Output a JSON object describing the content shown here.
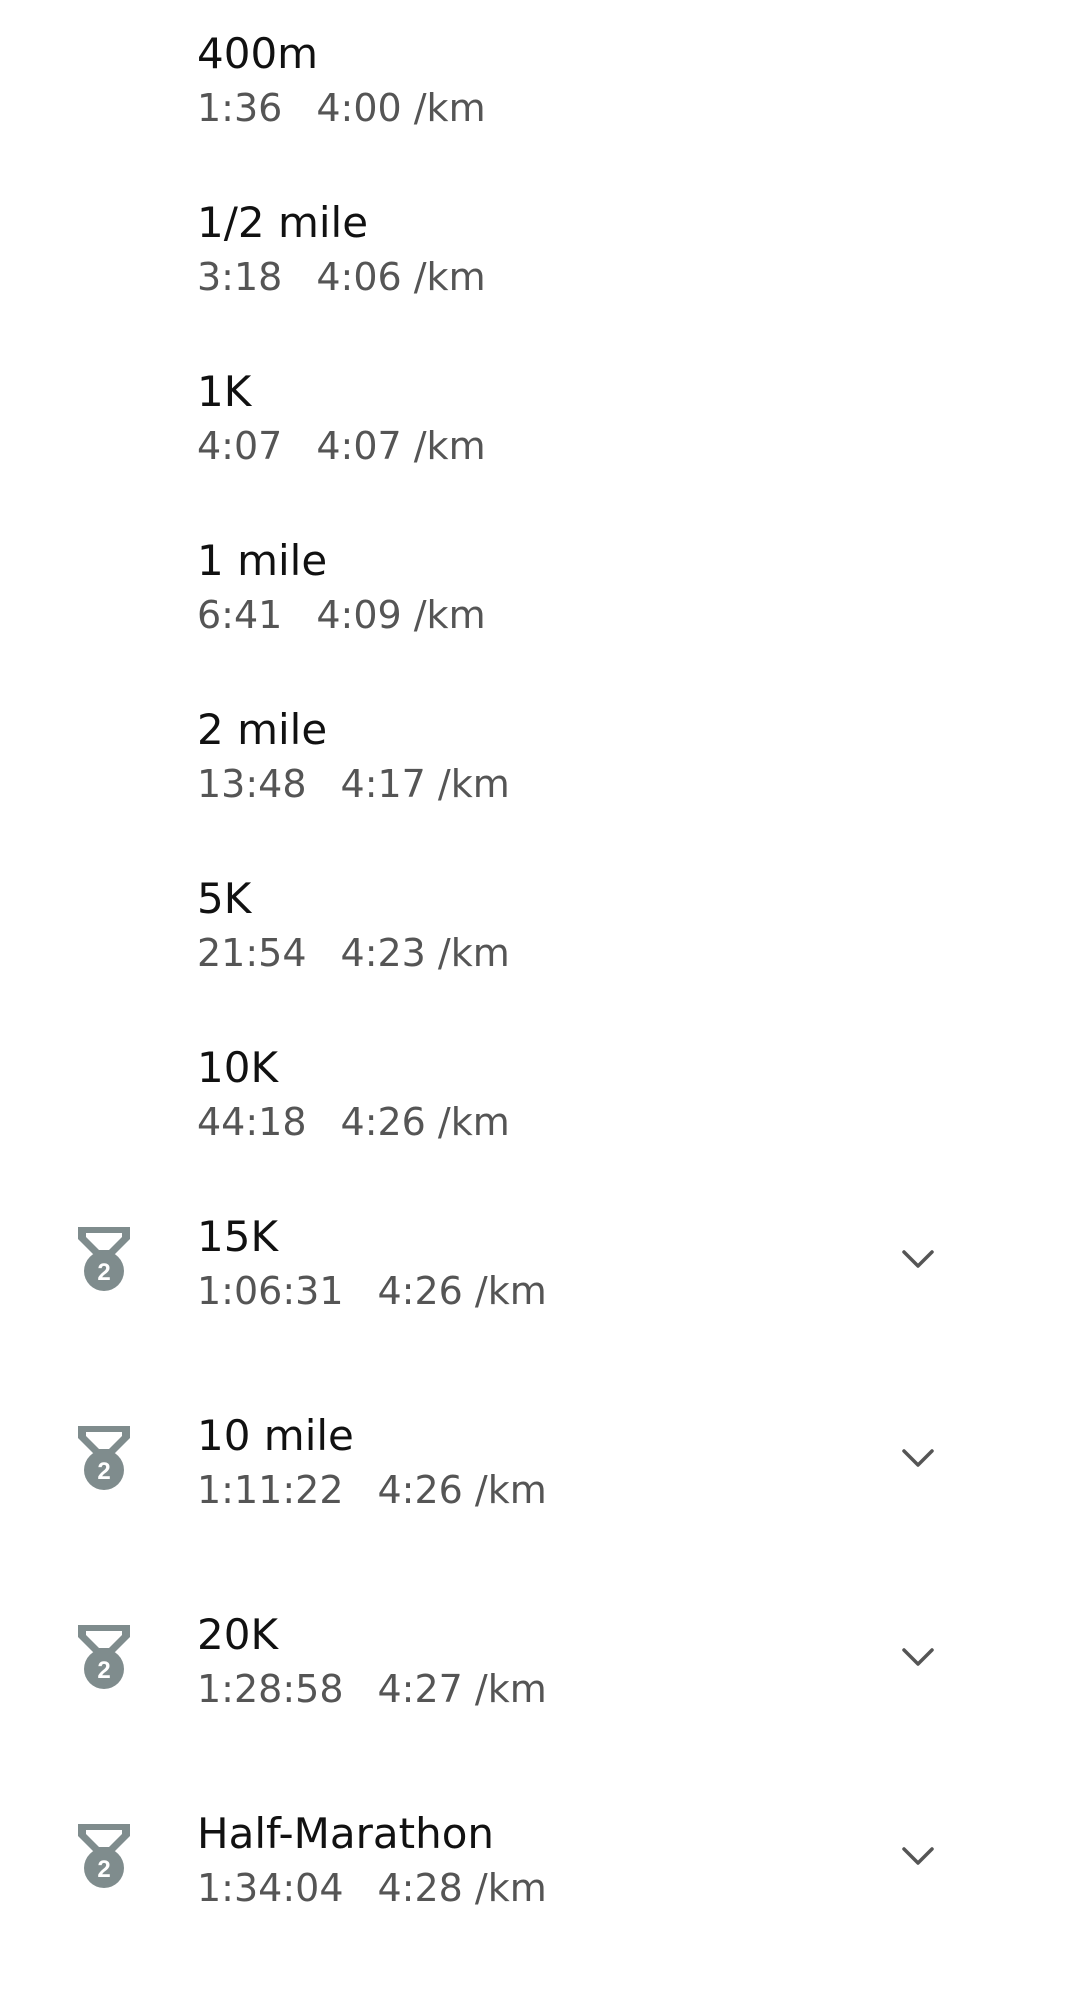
{
  "records": [
    {
      "name": "400m",
      "time": "1:36",
      "pace": "4:00 /km",
      "medal": null,
      "expandable": false
    },
    {
      "name": "1/2 mile",
      "time": "3:18",
      "pace": "4:06 /km",
      "medal": null,
      "expandable": false
    },
    {
      "name": "1K",
      "time": "4:07",
      "pace": "4:07 /km",
      "medal": null,
      "expandable": false
    },
    {
      "name": "1 mile",
      "time": "6:41",
      "pace": "4:09 /km",
      "medal": null,
      "expandable": false
    },
    {
      "name": "2 mile",
      "time": "13:48",
      "pace": "4:17 /km",
      "medal": null,
      "expandable": false
    },
    {
      "name": "5K",
      "time": "21:54",
      "pace": "4:23 /km",
      "medal": null,
      "expandable": false
    },
    {
      "name": "10K",
      "time": "44:18",
      "pace": "4:26 /km",
      "medal": null,
      "expandable": false
    },
    {
      "name": "15K",
      "time": "1:06:31",
      "pace": "4:26 /km",
      "medal": "2",
      "expandable": true
    },
    {
      "name": "10 mile",
      "time": "1:11:22",
      "pace": "4:26 /km",
      "medal": "2",
      "expandable": true
    },
    {
      "name": "20K",
      "time": "1:28:58",
      "pace": "4:27 /km",
      "medal": "2",
      "expandable": true
    },
    {
      "name": "Half-Marathon",
      "time": "1:34:04",
      "pace": "4:28 /km",
      "medal": "2",
      "expandable": true
    }
  ],
  "icons": {
    "medal": "silver-medal-icon",
    "expand": "chevron-down-icon"
  },
  "colors": {
    "medal": "#7f8c8d",
    "chevron": "#555555",
    "name": "#111111",
    "stats": "#555555"
  }
}
